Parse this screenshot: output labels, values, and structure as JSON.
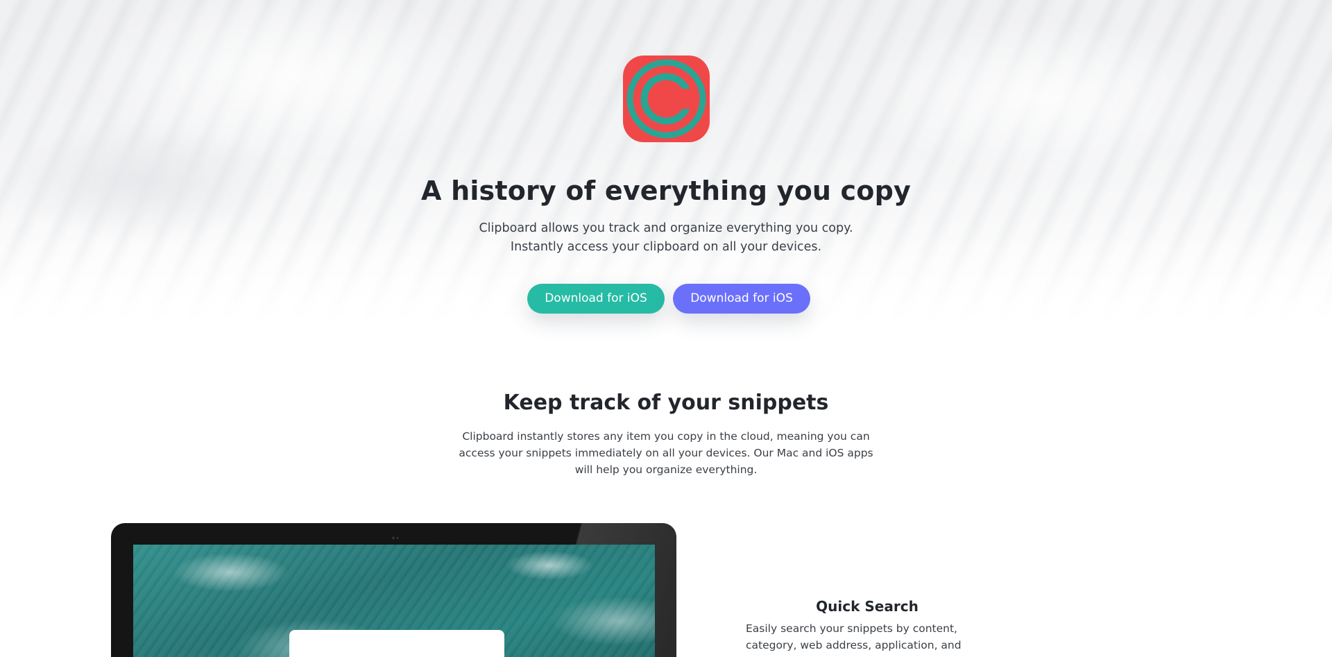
{
  "colors": {
    "ios_button": "#26bba4",
    "mac_button": "#6b70fb",
    "icon_red": "#f04848",
    "icon_teal": "#2aa595"
  },
  "hero": {
    "icon": "clipboard-app-icon",
    "title": "A history of everything you copy",
    "subtitle": "Clipboard allows you track and organize everything you copy. Instantly access your clipboard on all your devices.",
    "buttons": {
      "primary_label": "Download for iOS",
      "secondary_label": "Download for iOS"
    }
  },
  "snippets": {
    "title": "Keep track of your snippets",
    "description": "Clipboard instantly stores any item you copy in the cloud, meaning you can access your snippets immediately on all your devices. Our Mac and iOS apps will help you organize everything."
  },
  "features": {
    "quick_search": {
      "title": "Quick Search",
      "description": "Easily search your snippets by content, category, web address, application, and more."
    }
  }
}
